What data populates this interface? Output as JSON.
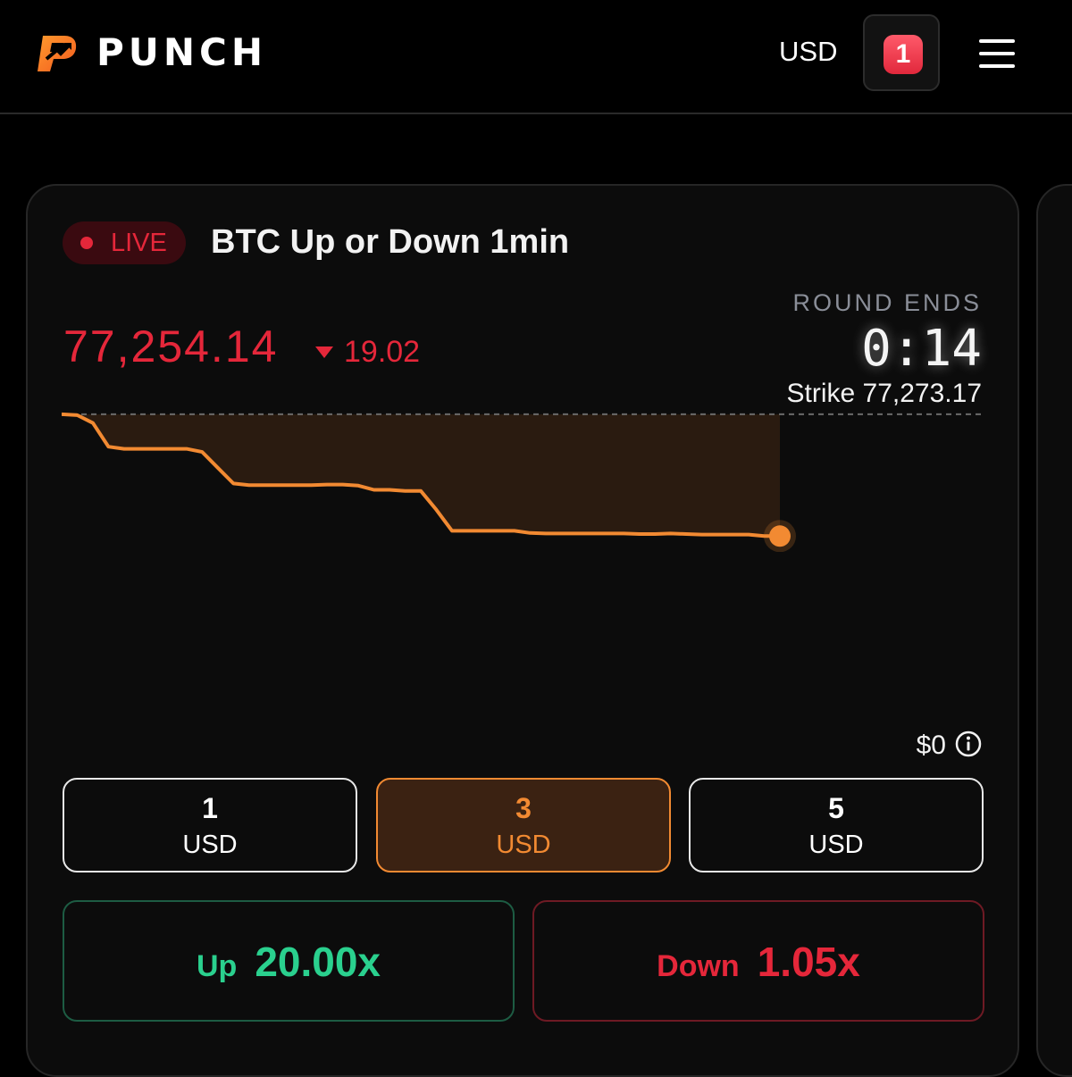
{
  "header": {
    "brand": "PUNCH",
    "currency": "USD",
    "notification_count": "1",
    "logo_icon": "punch-logo-icon",
    "menu_icon": "hamburger-menu-icon"
  },
  "market": {
    "status": "LIVE",
    "title": "BTC Up or Down 1min",
    "price": "77,254.14",
    "change": "19.02",
    "change_direction": "down",
    "round_label": "ROUND ENDS",
    "timer": "0:14",
    "strike": "Strike 77,273.17",
    "stake_total": "$0",
    "info_icon": "info-icon"
  },
  "chart_data": {
    "type": "line",
    "strike": 77273.17,
    "x": [
      0,
      1,
      2,
      3,
      4,
      5,
      6,
      7,
      8,
      9,
      10,
      11,
      12,
      13,
      14,
      15,
      16,
      17,
      18,
      19,
      20,
      21,
      22,
      23,
      24,
      25,
      26,
      27,
      28,
      29,
      30,
      31,
      32,
      33,
      34,
      35,
      36,
      37,
      38,
      39,
      40,
      41,
      42,
      43,
      44,
      45,
      46
    ],
    "values": [
      77273.17,
      77273.0,
      77271.5,
      77267.0,
      77266.6,
      77266.6,
      77266.6,
      77266.6,
      77266.6,
      77266.0,
      77263.0,
      77260.0,
      77259.7,
      77259.7,
      77259.7,
      77259.7,
      77259.7,
      77259.8,
      77259.8,
      77259.6,
      77258.8,
      77258.8,
      77258.6,
      77258.6,
      77255.0,
      77251.0,
      77251.0,
      77251.0,
      77251.0,
      77251.0,
      77250.6,
      77250.5,
      77250.5,
      77250.5,
      77250.5,
      77250.5,
      77250.5,
      77250.4,
      77250.4,
      77250.5,
      77250.4,
      77250.3,
      77250.3,
      77250.3,
      77250.3,
      77250.0,
      77250.0
    ],
    "last_value": 77254.14,
    "colors": {
      "line": "#f28a32",
      "fill": "#2a1b10",
      "strike_line": "#6a6a6a"
    }
  },
  "stakes": [
    {
      "amount": "1",
      "currency": "USD",
      "selected": false
    },
    {
      "amount": "3",
      "currency": "USD",
      "selected": true
    },
    {
      "amount": "5",
      "currency": "USD",
      "selected": false
    }
  ],
  "bets": {
    "up": {
      "label": "Up",
      "multiplier": "20.00x",
      "color": "#2ad08e"
    },
    "down": {
      "label": "Down",
      "multiplier": "1.05x",
      "color": "#e5273a"
    }
  },
  "colors": {
    "background": "#000000",
    "card": "#0c0c0c",
    "accent": "#f28a32",
    "live_red": "#e5273a",
    "up_green": "#2ad08e"
  }
}
